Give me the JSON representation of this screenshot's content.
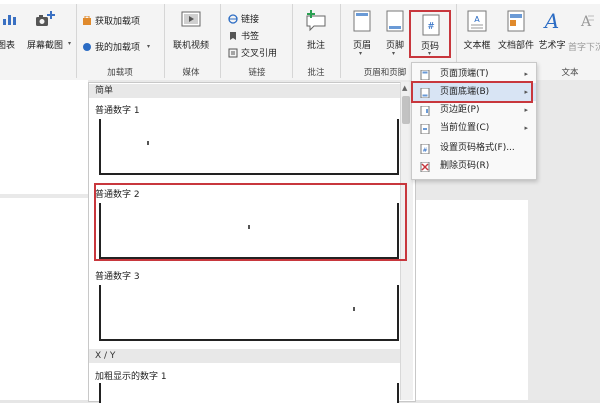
{
  "ribbon": {
    "groups": {
      "addins_label": "加载项",
      "media_label": "媒体",
      "links_label": "链接",
      "comments_label": "批注",
      "header_footer_label": "页眉和页脚",
      "text_label": "文本"
    },
    "chart_label": "图表",
    "screenshot_label": "屏幕截图",
    "get_addins_label": "获取加载项",
    "my_addins_label": "我的加载项",
    "online_video_label": "联机视频",
    "link_label": "链接",
    "bookmark_label": "书签",
    "cross_ref_label": "交叉引用",
    "comment_label": "批注",
    "header_label": "页眉",
    "footer_label": "页脚",
    "page_number_label": "页码",
    "textbox_label": "文本框",
    "doc_parts_label": "文档部件",
    "wordart_label": "艺术字",
    "dropcap_label": "首字下沉"
  },
  "gallery": {
    "category_simple": "简单",
    "category_xy": "X / Y",
    "items": [
      {
        "label": "普通数字 1"
      },
      {
        "label": "普通数字 2"
      },
      {
        "label": "普通数字 3"
      },
      {
        "label": "加粗显示的数字 1"
      }
    ]
  },
  "page_number_menu": {
    "items": [
      {
        "label": "页面顶端(T)",
        "has_submenu": true
      },
      {
        "label": "页面底端(B)",
        "has_submenu": true
      },
      {
        "label": "页边距(P)",
        "has_submenu": true
      },
      {
        "label": "当前位置(C)",
        "has_submenu": true
      },
      {
        "label": "设置页码格式(F)...",
        "has_submenu": false
      },
      {
        "label": "删除页码(R)",
        "has_submenu": false
      }
    ]
  },
  "colors": {
    "highlight": "#c8373d",
    "ribbon_bg": "#f4f4f4",
    "wordart_blue": "#2b6cc4"
  }
}
